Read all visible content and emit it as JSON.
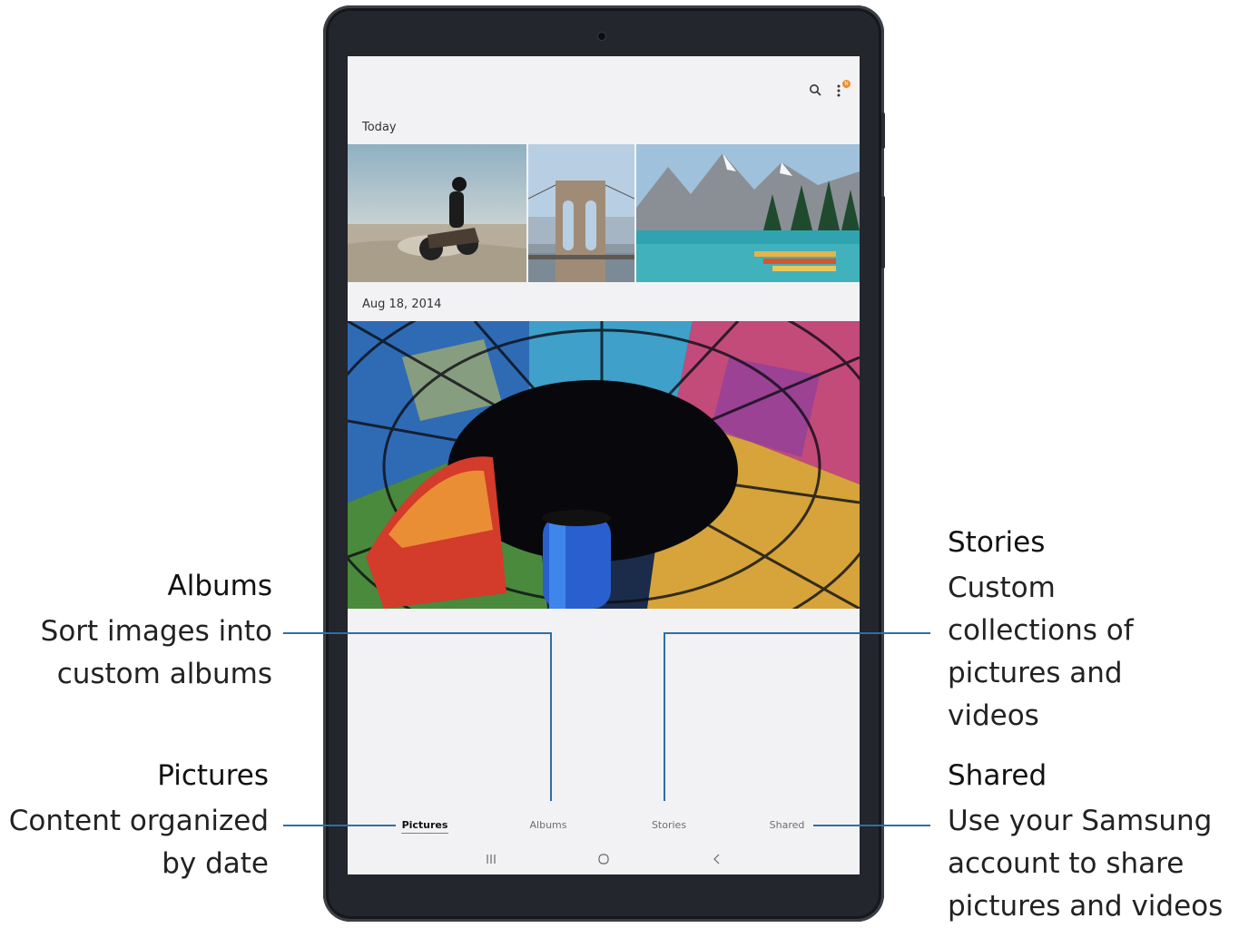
{
  "screen": {
    "sections": [
      {
        "label": "Today"
      },
      {
        "label": "Aug 18, 2014"
      }
    ],
    "icons": {
      "search": "search-icon",
      "more": "more-options-icon"
    },
    "notification_badge": "N",
    "tabs": [
      {
        "label": "Pictures",
        "active": true
      },
      {
        "label": "Albums",
        "active": false
      },
      {
        "label": "Stories",
        "active": false
      },
      {
        "label": "Shared",
        "active": false
      }
    ],
    "navbar": {
      "recents": "recents-icon",
      "home": "home-icon",
      "back": "back-icon"
    }
  },
  "annotations": {
    "albums": {
      "title": "Albums",
      "lines": [
        "Sort images into",
        "custom albums"
      ]
    },
    "pictures": {
      "title": "Pictures",
      "lines": [
        "Content organized",
        "by date"
      ]
    },
    "stories": {
      "title": "Stories",
      "lines": [
        "Custom",
        "collections of",
        "pictures and",
        "videos"
      ]
    },
    "shared": {
      "title": "Shared",
      "lines": [
        "Use your Samsung",
        "account to share",
        "pictures and videos"
      ]
    }
  },
  "colors": {
    "accent_line": "#2d6fa8",
    "badge": "#f08a24"
  }
}
